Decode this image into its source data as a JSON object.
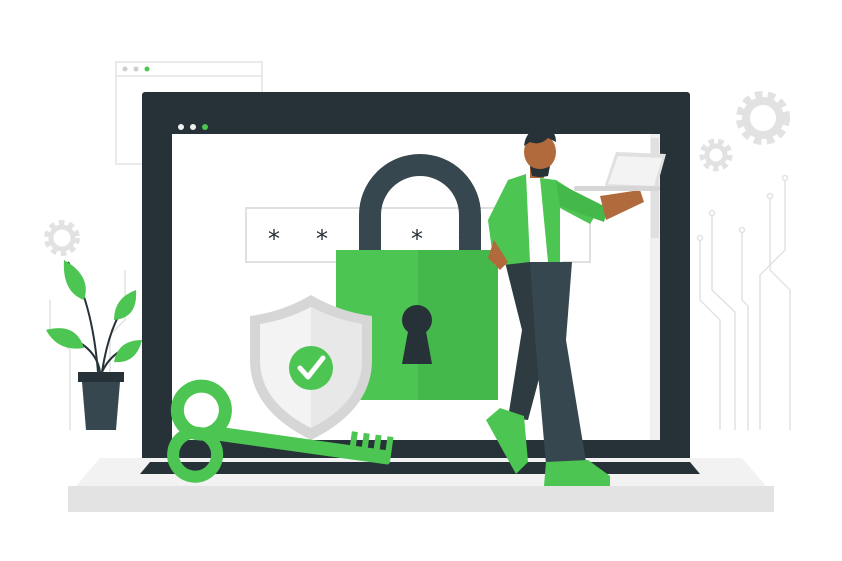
{
  "password_field": {
    "chars": [
      "*",
      "*",
      "*",
      "*",
      "*"
    ]
  },
  "colors": {
    "accent": "#4cc552",
    "accent_dark": "#3aa540",
    "dark": "#263238",
    "screen_bg": "#ffffff",
    "light_gray": "#f0f0f0",
    "line_gray": "#e0e0e0"
  },
  "icons": [
    "browser-window-icon",
    "padlock-icon",
    "keyhole-icon",
    "shield-icon",
    "checkmark-icon",
    "key-icon",
    "gear-icon",
    "plant-icon",
    "circuit-lines-icon",
    "laptop-icon",
    "person-figure"
  ]
}
